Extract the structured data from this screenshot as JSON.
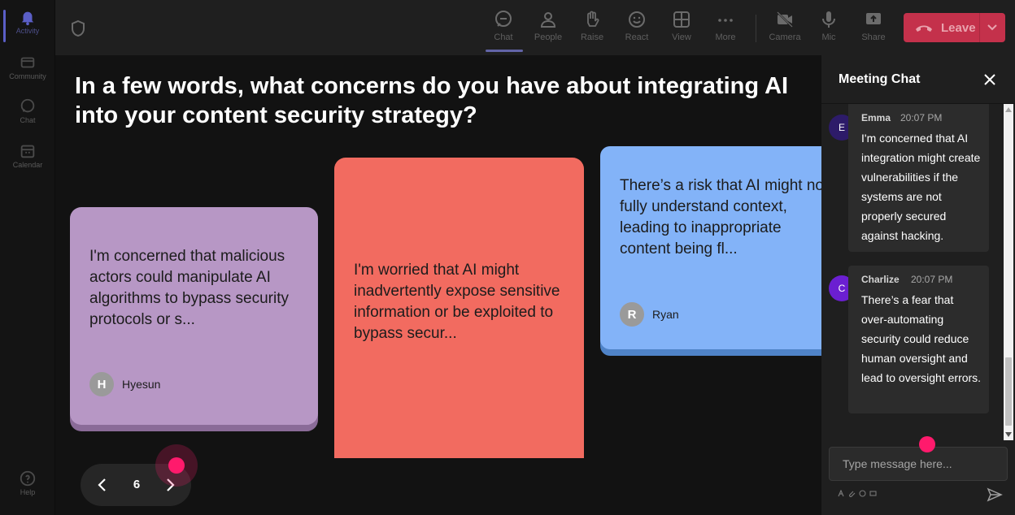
{
  "rail": {
    "items": [
      {
        "label": "Activity",
        "icon": "bell-icon",
        "active": true
      },
      {
        "label": "Community",
        "icon": "community-icon",
        "active": false
      },
      {
        "label": "Chat",
        "icon": "chat-icon",
        "active": false
      },
      {
        "label": "Calendar",
        "icon": "calendar-icon",
        "active": false
      },
      {
        "label": "Help",
        "icon": "help-icon",
        "active": false
      }
    ]
  },
  "toolbar": {
    "chat": "Chat",
    "people": "People",
    "raise": "Raise",
    "react": "React",
    "view": "View",
    "more": "More",
    "camera": "Camera",
    "mic": "Mic",
    "share": "Share",
    "leave": "Leave",
    "accent": "#6264a7",
    "leave_color": "#c4314b"
  },
  "stage": {
    "question": "In a few words, what concerns do you have about integrating AI into your content security strategy?",
    "cards": [
      {
        "text": "I'm concerned that malicious actors could manipulate AI algorithms to bypass security protocols or s...",
        "initial": "H",
        "author": "Hyesun",
        "color": "#b797c5"
      },
      {
        "text": "I'm worried that AI might inadvertently expose sensitive information or be exploited to bypass secur...",
        "initial": "",
        "author": "",
        "color": "#f26b60"
      },
      {
        "text": "There’s a risk that AI might not fully understand context, leading to inappropriate content being fl...",
        "initial": "R",
        "author": "Ryan",
        "color": "#83b3f8"
      }
    ],
    "pager": {
      "page": "6"
    }
  },
  "chat": {
    "title": "Meeting Chat",
    "messages": [
      {
        "initial": "E",
        "sender": "Emma",
        "time": "20:07 PM",
        "text": "I'm concerned that AI integration might create vulnerabilities if the systems are not properly secured against hacking.",
        "avatar_color": "#2d1b69"
      },
      {
        "initial": "C",
        "sender": "Charlize",
        "time": "20:07 PM",
        "text": "There’s a fear that over-automating security could reduce human oversight and lead to oversight errors.",
        "avatar_color": "#6b1fd1"
      }
    ],
    "input_placeholder": "Type message here..."
  }
}
